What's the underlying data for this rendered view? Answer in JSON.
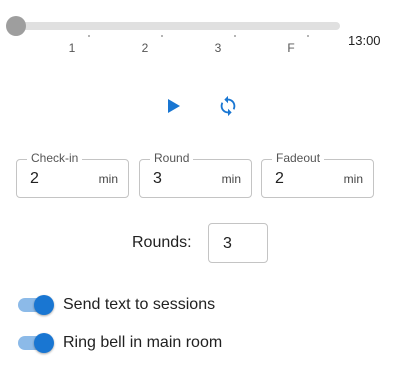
{
  "timeline": {
    "ticks": [
      "1",
      "2",
      "3",
      "F"
    ],
    "current_position_fraction": 0.0,
    "total_time": "13:00"
  },
  "controls": {
    "play_icon": "play-icon",
    "reset_icon": "refresh-icon",
    "accent_color": "#1976d2"
  },
  "fields": [
    {
      "label": "Check-in",
      "value": "2",
      "unit": "min"
    },
    {
      "label": "Round",
      "value": "3",
      "unit": "min"
    },
    {
      "label": "Fadeout",
      "value": "2",
      "unit": "min"
    }
  ],
  "rounds": {
    "label": "Rounds:",
    "value": "3"
  },
  "switches": [
    {
      "label": "Send text to sessions",
      "checked": true
    },
    {
      "label": "Ring bell in main room",
      "checked": true
    }
  ]
}
